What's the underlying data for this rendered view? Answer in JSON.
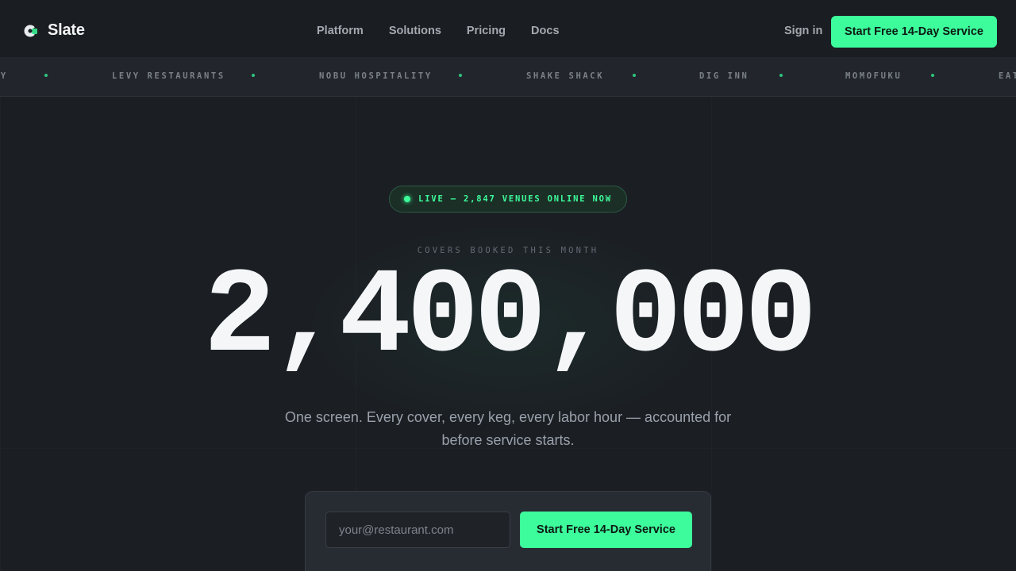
{
  "header": {
    "brand": "Slate",
    "nav": [
      "Platform",
      "Solutions",
      "Pricing",
      "Docs"
    ],
    "sign_in": "Sign in",
    "cta": "Start Free 14-Day Service"
  },
  "marquee": {
    "items": [
      "TY",
      "LEVY RESTAURANTS",
      "NOBU HOSPITALITY",
      "SHAKE SHACK",
      "DIG INN",
      "MOMOFUKU",
      "EAT"
    ]
  },
  "hero": {
    "live_badge": "LIVE — 2,847 VENUES ONLINE NOW",
    "stat_label": "COVERS BOOKED THIS MONTH",
    "stat_value": "2,400,000",
    "tagline": "One screen. Every cover, every keg, every labor hour — accounted for before service starts."
  },
  "signup": {
    "email_placeholder": "your@restaurant.com",
    "cta": "Start Free 14-Day Service"
  },
  "colors": {
    "accent": "#3dfc9b",
    "background": "#1b1f24",
    "header": "#1a1d21"
  }
}
